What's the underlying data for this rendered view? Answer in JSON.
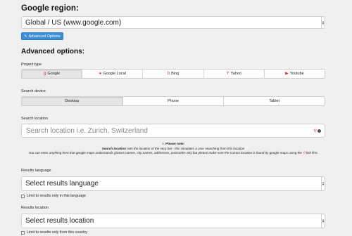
{
  "region": {
    "heading": "Google region:",
    "selected": "Global / US (www.google.com)",
    "advanced_button": "Advanced Options"
  },
  "advanced": {
    "heading": "Advanced options:",
    "project_type": {
      "label": "Project type",
      "options": [
        "Google",
        "Google Local",
        "Bing",
        "Yahoo",
        "Youtube"
      ],
      "active": "Google"
    },
    "search_device": {
      "label": "Search device",
      "options": [
        "Desktop",
        "Phone",
        "Tablet"
      ],
      "active": "Desktop"
    },
    "search_location": {
      "label": "Search location",
      "placeholder": "Search location i.e. Zurich, Switzerland",
      "note_title": "Please note:",
      "note_line1_bold": "Search location",
      "note_line1_rest": " sets the location of the serp bot - this simulates a user searching from this location",
      "note_line2_a": "You can enter anything here that google maps understands (places names, city names, addresses, postcodes etc) but please make sure the correct location is found by google maps using the ",
      "note_line2_b": " link first."
    },
    "results_language": {
      "label": "Results language",
      "selected": "Select results language",
      "checkbox": "Limit to results only in this language"
    },
    "results_location": {
      "label": "Results location",
      "selected": "Select results location",
      "checkbox": "Limit to results only from this country"
    }
  },
  "colors": {
    "accent": "#3b8fd6",
    "icon_red": "#d9342b",
    "background": "#f0f0f1"
  }
}
